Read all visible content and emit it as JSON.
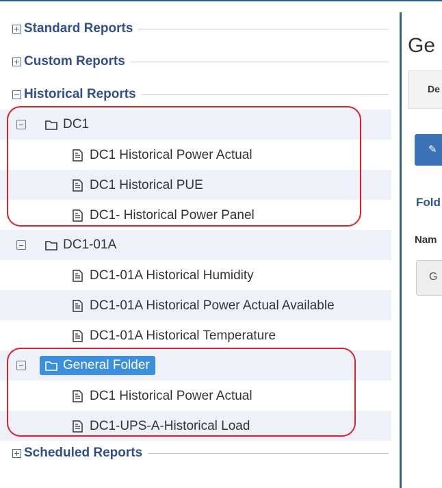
{
  "tree": {
    "sections_top": [
      {
        "label": "Standard Reports",
        "state": "collapsed"
      },
      {
        "label": "Custom Reports",
        "state": "collapsed"
      },
      {
        "label": "Historical Reports",
        "state": "expanded"
      }
    ],
    "folders": [
      {
        "name": "DC1",
        "selected": false,
        "items": [
          "DC1 Historical Power Actual",
          "DC1 Historical PUE",
          "DC1- Historical Power Panel"
        ]
      },
      {
        "name": "DC1-01A",
        "selected": false,
        "items": [
          "DC1-01A Historical Humidity",
          "DC1-01A Historical Power Actual Available",
          "DC1-01A Historical Temperature"
        ]
      },
      {
        "name": "General Folder",
        "selected": true,
        "items": [
          "DC1 Historical Power Actual",
          "DC1-UPS-A-Historical Load"
        ]
      }
    ],
    "section_bottom": {
      "label": "Scheduled Reports",
      "state": "collapsed"
    }
  },
  "right_panel": {
    "title": "Ge",
    "tab_label": "De",
    "edit_button_icon": "edit-icon",
    "folder_heading": "Fold",
    "name_label": "Nam",
    "name_value": "G"
  },
  "colors": {
    "accent": "#2f5f8a",
    "selected": "#3b8fdc",
    "highlight_outline": "#e0202a",
    "row_alt": "#eef1f8"
  }
}
